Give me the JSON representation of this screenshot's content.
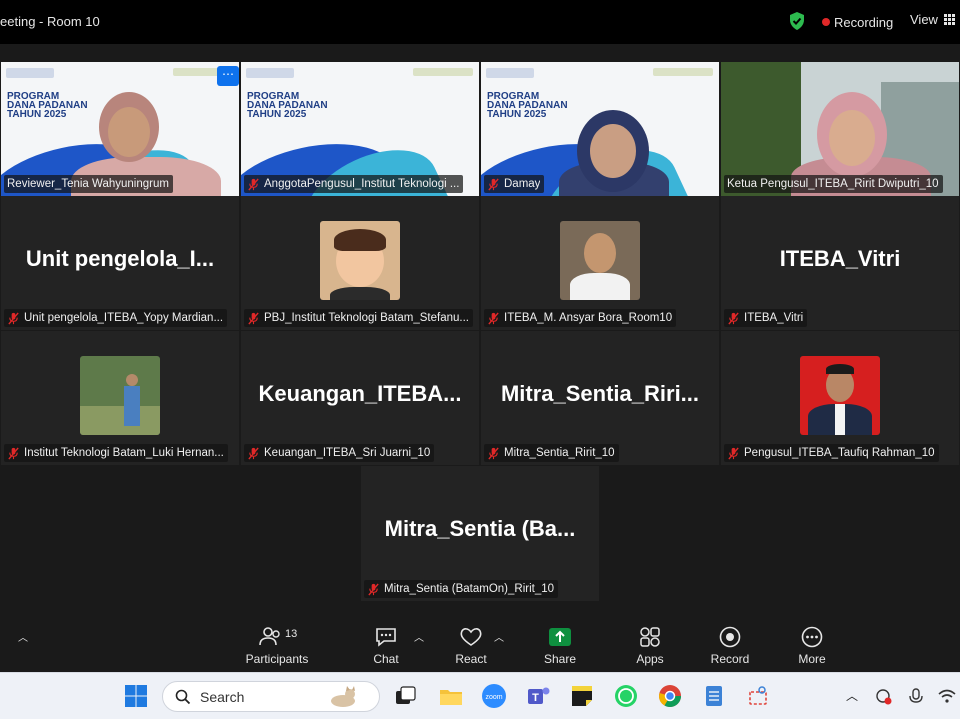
{
  "titlebar": {
    "title": "eeting - Room 10",
    "recording_label": "Recording",
    "view_label": "View",
    "shield_color": "#2dbb4f"
  },
  "slide_text": {
    "line1": "PROGRAM",
    "line2": "DANA PADANAN",
    "line3": "TAHUN 2025"
  },
  "tiles": [
    {
      "name": "Reviewer_Tenia Wahyuningrum",
      "muted": false,
      "kind": "video"
    },
    {
      "name": "AnggotaPengusul_Institut Teknologi ...",
      "muted": true,
      "kind": "video"
    },
    {
      "name": "Damay",
      "muted": true,
      "kind": "video"
    },
    {
      "name": "Ketua Pengusul_ITEBA_Ririt Dwiputri_10",
      "muted": false,
      "kind": "video"
    },
    {
      "name": "Unit pengelola_ITEBA_Yopy Mardian...",
      "muted": true,
      "kind": "text",
      "display": "Unit  pengelola_I..."
    },
    {
      "name": "PBJ_Institut Teknologi Batam_Stefanu...",
      "muted": true,
      "kind": "avatar"
    },
    {
      "name": "ITEBA_M. Ansyar Bora_Room10",
      "muted": true,
      "kind": "avatar"
    },
    {
      "name": "ITEBA_Vitri",
      "muted": true,
      "kind": "text",
      "display": "ITEBA_Vitri"
    },
    {
      "name": "Institut Teknologi Batam_Luki Hernan...",
      "muted": true,
      "kind": "avatar"
    },
    {
      "name": "Keuangan_ITEBA_Sri Juarni_10",
      "muted": true,
      "kind": "text",
      "display": "Keuangan_ITEBA..."
    },
    {
      "name": "Mitra_Sentia_Ririt_10",
      "muted": true,
      "kind": "text",
      "display": "Mitra_Sentia_Riri..."
    },
    {
      "name": "Pengusul_ITEBA_Taufiq Rahman_10",
      "muted": true,
      "kind": "avatar"
    },
    {
      "name": "Mitra_Sentia (BatamOn)_Ririt_10",
      "muted": true,
      "kind": "text",
      "display": "Mitra_Sentia  (Ba..."
    }
  ],
  "toolbar": {
    "participants_label": "Participants",
    "participants_count": "13",
    "chat_label": "Chat",
    "react_label": "React",
    "share_label": "Share",
    "apps_label": "Apps",
    "record_label": "Record",
    "more_label": "More",
    "share_color": "#0e8f3f"
  },
  "taskbar": {
    "search_placeholder": "Search"
  }
}
